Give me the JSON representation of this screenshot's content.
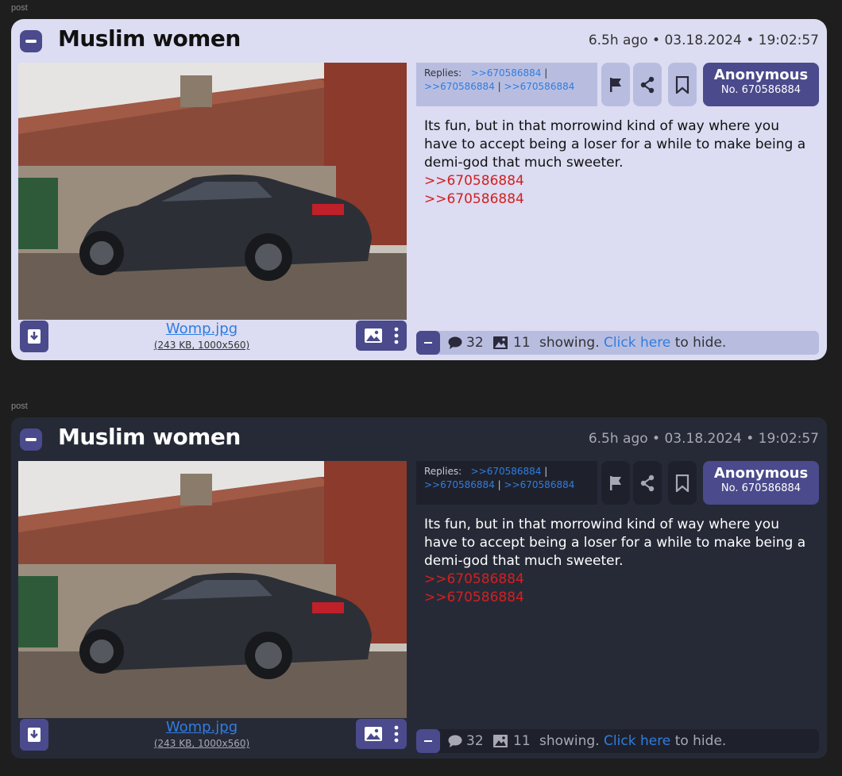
{
  "posts": [
    {
      "section_label": "post",
      "theme": "light",
      "title": "Muslim women",
      "meta": "6.5h ago • 03.18.2024 • 19:02:57",
      "image": {
        "file_name": "Womp.jpg",
        "file_info": "(243 KB, 1000x560)"
      },
      "replies_label": "Replies:",
      "replies": [
        ">>670586884",
        ">>670586884",
        ">>670586884"
      ],
      "reply_sep": "|",
      "author": {
        "name": "Anonymous",
        "number": "No. 670586884"
      },
      "body": {
        "text": "Its fun, but in that morrowind kind of way where you have to accept being a loser for a while to make being a demi-god that much sweeter.",
        "quotes": [
          ">>670586884",
          ">>670586884"
        ]
      },
      "status": {
        "reply_count": "32",
        "image_count": "11",
        "showing": "showing.",
        "click_here": "Click here",
        "to_hide": "to hide."
      }
    },
    {
      "section_label": "post",
      "theme": "dark",
      "title": "Muslim women",
      "meta": "6.5h ago • 03.18.2024 • 19:02:57",
      "image": {
        "file_name": "Womp.jpg",
        "file_info": "(243 KB, 1000x560)"
      },
      "replies_label": "Replies:",
      "replies": [
        ">>670586884",
        ">>670586884",
        ">>670586884"
      ],
      "reply_sep": "|",
      "author": {
        "name": "Anonymous",
        "number": "No. 670586884"
      },
      "body": {
        "text": "Its fun, but in that morrowind kind of way where you have to accept being a loser for a while to make being a demi-god that much sweeter.",
        "quotes": [
          ">>670586884",
          ">>670586884"
        ]
      },
      "status": {
        "reply_count": "32",
        "image_count": "11",
        "showing": "showing.",
        "click_here": "Click here",
        "to_hide": "to hide."
      }
    }
  ],
  "icons": {
    "collapse": "minus-icon",
    "download": "download-icon",
    "image": "image-icon",
    "more": "kebab-menu-icon",
    "flag": "flag-icon",
    "share": "share-icon",
    "bookmark": "bookmark-icon",
    "comment": "comment-icon"
  },
  "colors": {
    "accent": "#4a4a8c",
    "link": "#2f7de1",
    "quote": "#d32020",
    "light_card": "#dcdcf2",
    "dark_card": "#262a37"
  }
}
